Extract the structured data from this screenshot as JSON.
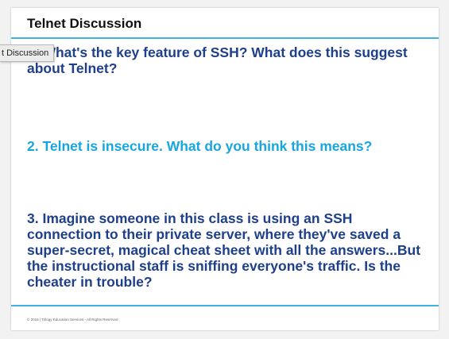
{
  "slide": {
    "title": "Telnet Discussion",
    "questions": [
      "1. What's the key feature of SSH? What does this suggest about Telnet?",
      "2. Telnet is insecure. What do you think this means?",
      "3. Imagine someone in this class is using an SSH connection to their private server, where they've saved a super-secret, magical cheat sheet with all the answers...But the instructional staff is sniffing everyone's traffic. Is the cheater in trouble?"
    ],
    "footer": "© 2018 | Trilogy Education Services - All Rights Reserved"
  },
  "tooltip": {
    "text": "t Discussion"
  },
  "colors": {
    "accent_rule": "#3fb3e6",
    "question_dark": "#1e3f8a",
    "question_highlight": "#17a6df"
  }
}
